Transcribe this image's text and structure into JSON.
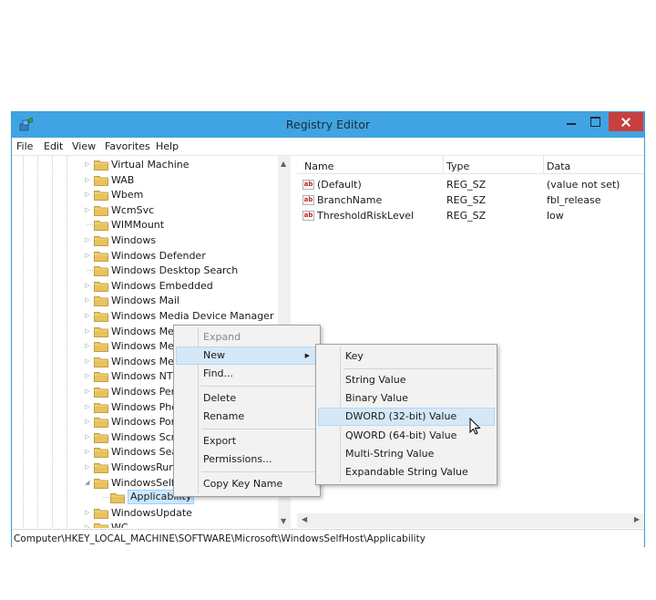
{
  "window": {
    "title": "Registry Editor"
  },
  "menubar": [
    "File",
    "Edit",
    "View",
    "Favorites",
    "Help"
  ],
  "tree": {
    "items": [
      {
        "label": "Virtual Machine",
        "expandable": true
      },
      {
        "label": "WAB",
        "expandable": true
      },
      {
        "label": "Wbem",
        "expandable": true
      },
      {
        "label": "WcmSvc",
        "expandable": true
      },
      {
        "label": "WIMMount",
        "expandable": false
      },
      {
        "label": "Windows",
        "expandable": true
      },
      {
        "label": "Windows Defender",
        "expandable": true
      },
      {
        "label": "Windows Desktop Search",
        "expandable": false
      },
      {
        "label": "Windows Embedded",
        "expandable": true
      },
      {
        "label": "Windows Mail",
        "expandable": true
      },
      {
        "label": "Windows Media Device Manager",
        "expandable": true
      },
      {
        "label": "Windows Med",
        "expandable": true
      },
      {
        "label": "Windows Med",
        "expandable": true
      },
      {
        "label": "Windows Mes",
        "expandable": true
      },
      {
        "label": "Windows NT",
        "expandable": true
      },
      {
        "label": "Windows Perf",
        "expandable": true
      },
      {
        "label": "Windows Pho",
        "expandable": true
      },
      {
        "label": "Windows Port",
        "expandable": true
      },
      {
        "label": "Windows Scri",
        "expandable": true
      },
      {
        "label": "Windows Sear",
        "expandable": true
      },
      {
        "label": "WindowsRunt",
        "expandable": true
      },
      {
        "label": "WindowsSelfH",
        "expandable": true,
        "expanded": true
      },
      {
        "label": "Applicability",
        "expandable": false,
        "child": true,
        "selected": true
      },
      {
        "label": "WindowsUpdate",
        "expandable": true
      },
      {
        "label": "WC",
        "expandable": true
      }
    ]
  },
  "list": {
    "columns": [
      "Name",
      "Type",
      "Data"
    ],
    "rows": [
      {
        "name": "(Default)",
        "type": "REG_SZ",
        "data": "(value not set)"
      },
      {
        "name": "BranchName",
        "type": "REG_SZ",
        "data": "fbl_release"
      },
      {
        "name": "ThresholdRiskLevel",
        "type": "REG_SZ",
        "data": "low"
      }
    ]
  },
  "status": {
    "path": "Computer\\HKEY_LOCAL_MACHINE\\SOFTWARE\\Microsoft\\WindowsSelfHost\\Applicability"
  },
  "context_menu": {
    "items": [
      {
        "label": "Expand",
        "disabled": true
      },
      {
        "label": "New",
        "submenu": true,
        "highlighted": true
      },
      {
        "label": "Find..."
      },
      {
        "label": "Delete"
      },
      {
        "label": "Rename"
      },
      {
        "label": "Export"
      },
      {
        "label": "Permissions..."
      },
      {
        "label": "Copy Key Name"
      }
    ]
  },
  "submenu": {
    "items": [
      {
        "label": "Key"
      },
      {
        "label": "String Value"
      },
      {
        "label": "Binary Value"
      },
      {
        "label": "DWORD (32-bit) Value",
        "highlighted": true
      },
      {
        "label": "QWORD (64-bit) Value"
      },
      {
        "label": "Multi-String Value"
      },
      {
        "label": "Expandable String Value"
      }
    ]
  },
  "colors": {
    "titlebar": "#41a4e2",
    "close": "#c7403d",
    "highlight": "#d5e8f7",
    "selected": "#cce8ff",
    "folder": "#e8c25a"
  }
}
